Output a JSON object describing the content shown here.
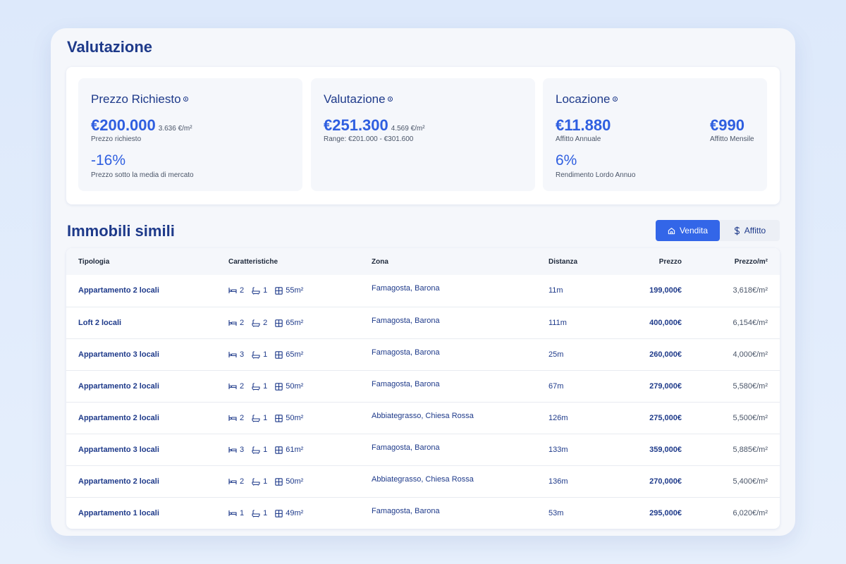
{
  "valuation": {
    "title": "Valutazione",
    "asking": {
      "heading": "Prezzo Richiesto",
      "price": "€200.000",
      "per_sqm": "3.636 €/m²",
      "price_label": "Prezzo richiesto",
      "delta": "-16%",
      "delta_label": "Prezzo sotto la media di mercato"
    },
    "estimate": {
      "heading": "Valutazione",
      "price": "€251.300",
      "per_sqm": "4.569 €/m²",
      "range": "Range: €201.000 - €301.600"
    },
    "rent": {
      "heading": "Locazione",
      "annual": "€11.880",
      "annual_label": "Affitto Annuale",
      "monthly": "€990",
      "monthly_label": "Affitto Mensile",
      "yield": "6%",
      "yield_label": "Rendimento Lordo Annuo"
    }
  },
  "similar": {
    "title": "Immobili simili",
    "toggle": {
      "sale": "Vendita",
      "rent": "Affitto",
      "active": "sale"
    },
    "columns": {
      "type": "Tipologia",
      "features": "Caratteristiche",
      "zone": "Zona",
      "distance": "Distanza",
      "price": "Prezzo",
      "price_sqm": "Prezzo/m²"
    },
    "rows": [
      {
        "type": "Appartamento 2 locali",
        "beds": "2",
        "baths": "1",
        "area": "55m²",
        "zone": "Famagosta, Barona",
        "distance": "11m",
        "price": "199,000€",
        "price_sqm": "3,618€/m²"
      },
      {
        "type": "Loft 2 locali",
        "beds": "2",
        "baths": "2",
        "area": "65m²",
        "zone": "Famagosta, Barona",
        "distance": "111m",
        "price": "400,000€",
        "price_sqm": "6,154€/m²"
      },
      {
        "type": "Appartamento 3 locali",
        "beds": "3",
        "baths": "1",
        "area": "65m²",
        "zone": "Famagosta, Barona",
        "distance": "25m",
        "price": "260,000€",
        "price_sqm": "4,000€/m²"
      },
      {
        "type": "Appartamento 2 locali",
        "beds": "2",
        "baths": "1",
        "area": "50m²",
        "zone": "Famagosta, Barona",
        "distance": "67m",
        "price": "279,000€",
        "price_sqm": "5,580€/m²"
      },
      {
        "type": "Appartamento 2 locali",
        "beds": "2",
        "baths": "1",
        "area": "50m²",
        "zone": "Abbiategrasso, Chiesa Rossa",
        "distance": "126m",
        "price": "275,000€",
        "price_sqm": "5,500€/m²"
      },
      {
        "type": "Appartamento 3 locali",
        "beds": "3",
        "baths": "1",
        "area": "61m²",
        "zone": "Famagosta, Barona",
        "distance": "133m",
        "price": "359,000€",
        "price_sqm": "5,885€/m²"
      },
      {
        "type": "Appartamento 2 locali",
        "beds": "2",
        "baths": "1",
        "area": "50m²",
        "zone": "Abbiategrasso, Chiesa Rossa",
        "distance": "136m",
        "price": "270,000€",
        "price_sqm": "5,400€/m²"
      },
      {
        "type": "Appartamento 1 locali",
        "beds": "1",
        "baths": "1",
        "area": "49m²",
        "zone": "Famagosta, Barona",
        "distance": "53m",
        "price": "295,000€",
        "price_sqm": "6,020€/m²"
      }
    ]
  },
  "icons": {
    "info": "info-icon",
    "bed": "bed-icon",
    "bath": "bath-icon",
    "area": "area-icon",
    "home": "home-icon",
    "dollar": "dollar-icon"
  },
  "colors": {
    "accent": "#3366e8",
    "primary_text": "#1e3a8a"
  }
}
